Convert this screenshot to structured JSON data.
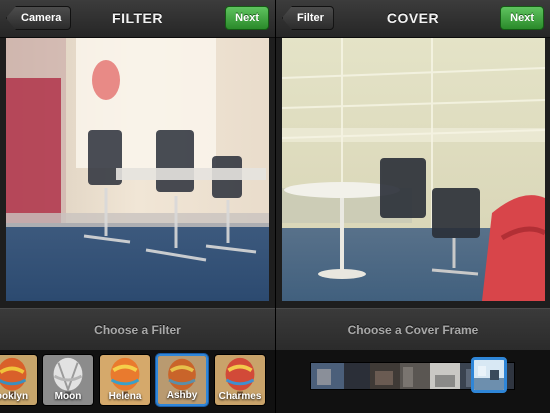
{
  "filter_screen": {
    "title": "FILTER",
    "back_label": "Camera",
    "next_label": "Next",
    "caption": "Choose a Filter",
    "filters": [
      {
        "label": "ooklyn",
        "icon": "balloon-thumbnail"
      },
      {
        "label": "Moon",
        "icon": "balloon-thumbnail"
      },
      {
        "label": "Helena",
        "icon": "balloon-thumbnail"
      },
      {
        "label": "Ashby",
        "icon": "balloon-thumbnail",
        "selected": true
      },
      {
        "label": "Charmes",
        "icon": "balloon-thumbnail"
      }
    ]
  },
  "cover_screen": {
    "title": "COVER",
    "back_label": "Filter",
    "next_label": "Next",
    "caption": "Choose a Cover Frame"
  },
  "colors": {
    "next_green": "#2a8a2a",
    "selection_blue": "#2f86d8",
    "navbar_dark": "#262626"
  }
}
